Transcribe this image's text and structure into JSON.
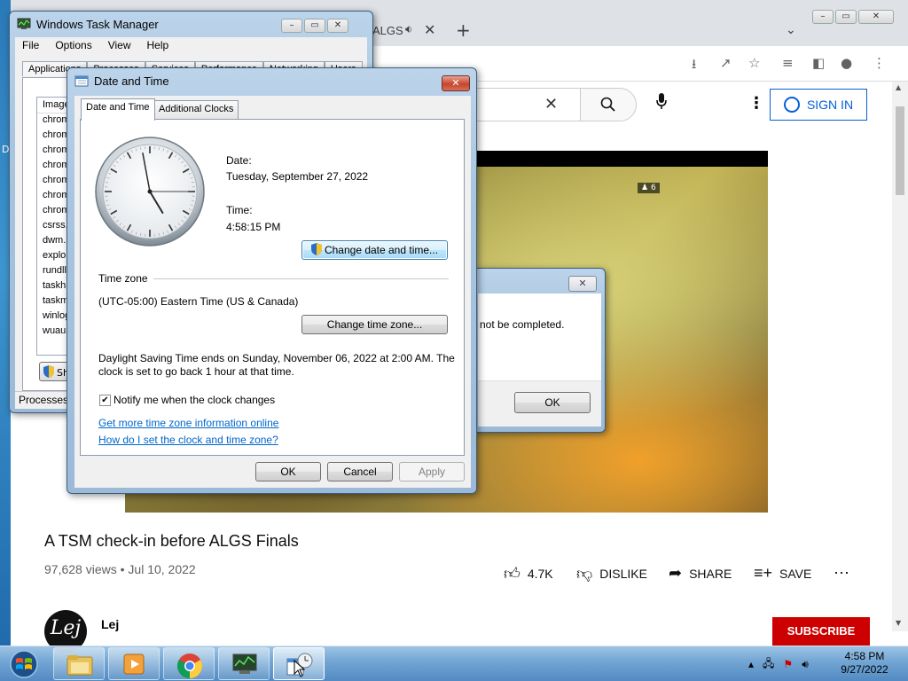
{
  "chrome": {
    "tab_title": "ALGS",
    "youtube": {
      "signin_label": "SIGN IN",
      "video_title": "A TSM check-in before ALGS Finals",
      "views": "97,628 views",
      "date": "Jul 10, 2022",
      "like_count": "4.7K",
      "dislike_label": "DISLIKE",
      "share_label": "SHARE",
      "save_label": "SAVE",
      "channel_name": "Lej",
      "subscribe_label": "SUBSCRIBE",
      "squad_tag": "6"
    }
  },
  "taskmgr": {
    "title": "Windows Task Manager",
    "menu": [
      "File",
      "Options",
      "View",
      "Help"
    ],
    "tabs": [
      "Applications",
      "Processes",
      "Services",
      "Performance",
      "Networking",
      "Users"
    ],
    "column_header": "Image",
    "processes": [
      "chrom",
      "chrom",
      "chrom",
      "chrom",
      "chrom",
      "chrom",
      "chrom",
      "csrss.",
      "dwm.",
      "explo",
      "rundll",
      "taskh",
      "taskm",
      "winlog",
      "wuau"
    ],
    "show_button": "Show processes from all users",
    "status": "Processes:"
  },
  "error_dialog": {
    "message": "not be completed.",
    "ok_label": "OK"
  },
  "datetime": {
    "title": "Date and Time",
    "tabs": [
      "Date and Time",
      "Additional Clocks"
    ],
    "date_label": "Date:",
    "date_value": "Tuesday, September 27, 2022",
    "time_label": "Time:",
    "time_value": "4:58:15 PM",
    "change_datetime_button": "Change date and time...",
    "timezone_heading": "Time zone",
    "timezone_value": "(UTC-05:00) Eastern Time (US & Canada)",
    "change_timezone_button": "Change time zone...",
    "dst_line1": "Daylight Saving Time ends on Sunday, November 06, 2022 at 2:00 AM. The",
    "dst_line2": "clock is set to go back 1 hour at that time.",
    "notify_label": "Notify me when the clock changes",
    "notify_checked": true,
    "link_more_info": "Get more time zone information online",
    "link_how_set": "How do I set the clock and time zone?",
    "ok_label": "OK",
    "cancel_label": "Cancel",
    "apply_label": "Apply",
    "clock_time": {
      "hours": 4,
      "minutes": 58,
      "seconds": 15
    }
  },
  "taskbar": {
    "clock_time": "4:58 PM",
    "clock_date": "9/27/2022"
  },
  "colors": {
    "youtube_blue": "#065fd4",
    "youtube_red": "#cc0000",
    "link_blue": "#0066cc",
    "close_red": "#c8452c"
  },
  "icons": [
    "windows-start-icon",
    "explorer-folder-icon",
    "media-player-icon",
    "chrome-icon",
    "task-manager-icon",
    "date-time-icon"
  ]
}
